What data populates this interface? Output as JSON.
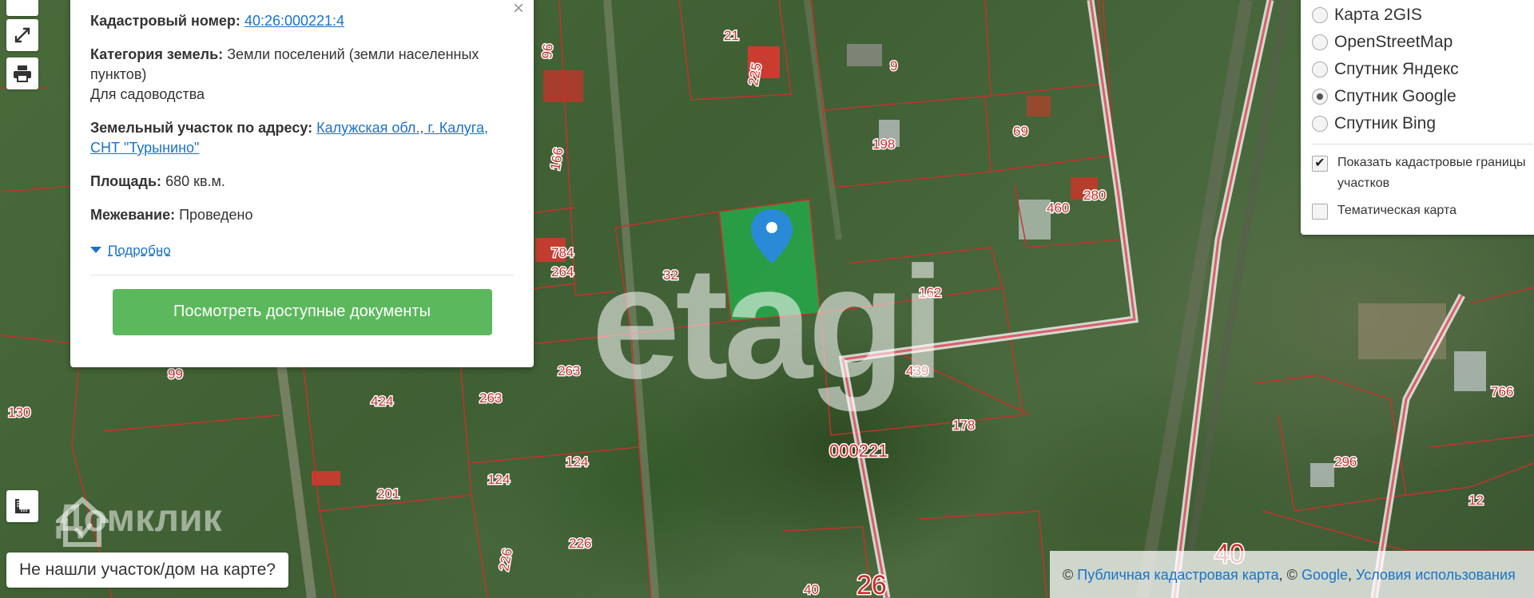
{
  "popup": {
    "cadastral_key": "Кадастровый номер:",
    "cadastral_value": "40:26:000221:4",
    "category_key": "Категория земель:",
    "category_value": "Земли поселений (земли населенных пунктов)",
    "category_use": "Для садоводства",
    "address_key": "Земельный участок по адресу:",
    "address_value": "Калужская обл., г. Калуга, СНТ \"Турынино\"",
    "area_key": "Площадь:",
    "area_value": "680 кв.м.",
    "survey_key": "Межевание:",
    "survey_value": "Проведено",
    "more_label": "Подробно",
    "docs_button": "Посмотреть доступные документы",
    "close_glyph": "×"
  },
  "layers": {
    "options": [
      {
        "label": "Карта 2GIS",
        "selected": false
      },
      {
        "label": "OpenStreetMap",
        "selected": false
      },
      {
        "label": "Спутник Яндекс",
        "selected": false
      },
      {
        "label": "Спутник Google",
        "selected": true
      },
      {
        "label": "Спутник Bing",
        "selected": false
      }
    ],
    "checks": [
      {
        "label": "Показать кадастровые границы участков",
        "checked": true
      },
      {
        "label": "Тематическая карта",
        "checked": false
      }
    ]
  },
  "controls": {
    "fullscreen_icon": "expand-icon",
    "print_icon": "printer-icon",
    "ruler_icon": "ruler-icon",
    "not_found_label": "Не нашли участок/дом на карте?"
  },
  "watermarks": {
    "etagi": "etagi",
    "domclick": "Домклик"
  },
  "attribution": {
    "prefix": "© ",
    "link1": "Публичная кадастровая карта",
    "sep": ", © ",
    "link2": "Google",
    "sep2": ", ",
    "link3": "Условия использования"
  },
  "map_labels": {
    "plots": [
      "21",
      "225",
      "9",
      "96",
      "198",
      "69",
      "166",
      "280",
      "460",
      "784",
      "264",
      "32",
      "162",
      "99",
      "263",
      "130",
      "424",
      "263",
      "439",
      "178",
      "766",
      "124",
      "124",
      "201",
      "296",
      "12",
      "226",
      "226",
      "40",
      "26",
      "40"
    ],
    "quarter": "000221"
  },
  "colors": {
    "accent_link": "#1a73c8",
    "button_green": "#5cb85c",
    "boundary_red": "#c9302c",
    "selected_plot": "#22b14c",
    "marker_blue": "#2a8ad8"
  }
}
